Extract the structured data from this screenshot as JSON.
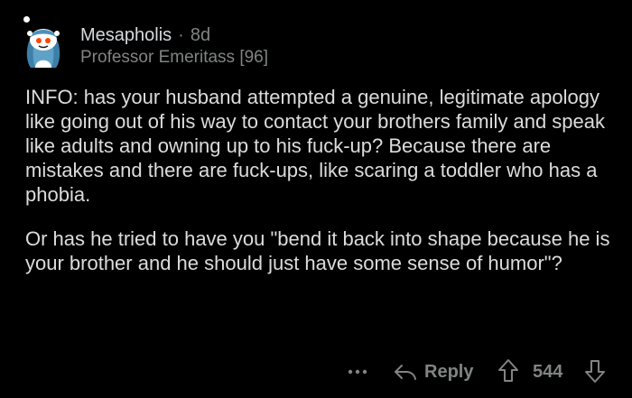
{
  "comment": {
    "author": "Mesapholis",
    "separator": "·",
    "age": "8d",
    "flair": "Professor Emeritass [96]",
    "paragraphs": [
      "INFO: has your husband attempted a genuine, legitimate apology like going out of his way to contact your brothers family and speak like adults and owning up to his fuck-up? Because there are mistakes and there are fuck-ups, like scaring a toddler who has a phobia.",
      "Or has he tried to have you \"bend it back into shape because he is your brother and he should just have some sense of humor\"?"
    ]
  },
  "actions": {
    "more_icon": "more-options-icon",
    "reply_icon": "reply-arrow-icon",
    "reply_label": "Reply",
    "upvote_icon": "upvote-arrow-icon",
    "score": "544",
    "downvote_icon": "downvote-arrow-icon"
  },
  "colors": {
    "background": "#000000",
    "text": "#d7dadc",
    "muted": "#818384",
    "avatar_accent": "#ff4500"
  }
}
